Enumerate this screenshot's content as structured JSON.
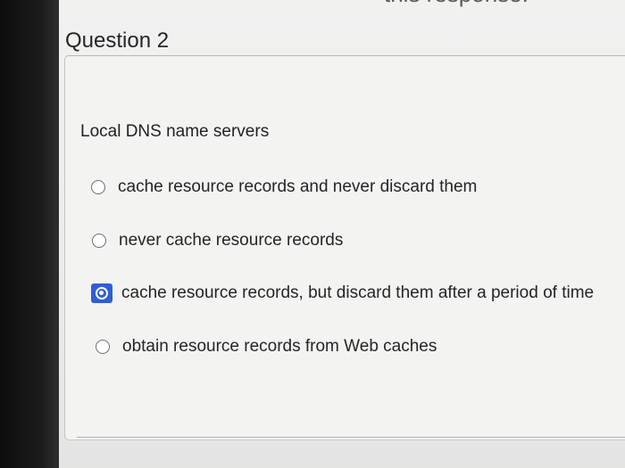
{
  "quiz": {
    "question_title": "Question 2",
    "prompt": "Local DNS name servers",
    "options": [
      {
        "label": "cache resource records and never discard them",
        "selected": false
      },
      {
        "label": "never cache resource records",
        "selected": false
      },
      {
        "label": "cache resource records, but discard them after a period of time",
        "selected": true
      },
      {
        "label": "obtain resource records from Web caches",
        "selected": false
      }
    ]
  },
  "header_fragment": "this response."
}
